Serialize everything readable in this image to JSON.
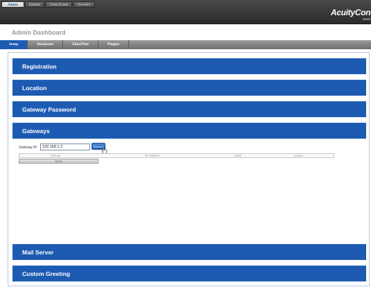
{
  "top_tabs": [
    "Admin",
    "Updates",
    "Green Screen",
    "Overview"
  ],
  "logo": {
    "text": "AcuityCon",
    "sub": "SCHE"
  },
  "page_title": "Admin Dashboard",
  "nav_tabs": [
    "Setup",
    "Databases",
    "FloorPlan",
    "Plugins"
  ],
  "sections": {
    "registration": "Registration",
    "location": "Location",
    "gateway_password": "Gateway Password",
    "gateways": "Gateways",
    "mail_server": "Mail Server",
    "custom_greeting": "Custom Greeting"
  },
  "gateways": {
    "ip_label": "Gateway IP:",
    "ip_value": "192.168.1.2",
    "discover_label": "Discover",
    "table_headers": [
      "Include",
      "IP Address",
      "Label",
      "Status"
    ],
    "save_label": "Save"
  },
  "colors": {
    "accent": "#1d5bb2",
    "topbar": "#333333",
    "nav": "#808080"
  }
}
